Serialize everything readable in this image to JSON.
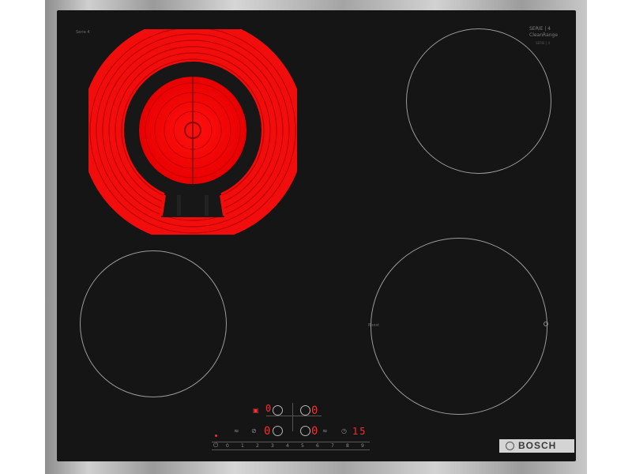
{
  "hob": {
    "top_left_mark": "Serie 4",
    "top_right_badge_line1": "SERIE | 4",
    "top_right_badge_line2": "CleanRange",
    "top_right_badge_line3": "SERIE | 4",
    "zone_bl_label": "",
    "zone_br_left_label": "Boost",
    "zone_br_right_label": "",
    "brand": "BOSCH"
  },
  "controls": {
    "display_front_left": "0",
    "display_front_right": "0",
    "display_rear_left": "0",
    "display_rear_right": "0",
    "timer_display": "15",
    "slider_labels": [
      "0",
      "1",
      "2",
      "3",
      "4",
      "5",
      "6",
      "7",
      "8",
      "9"
    ],
    "active_zone_color": "#ff2020"
  },
  "icons": [
    "power-icon",
    "child-lock-icon",
    "timer-icon",
    "boost-icon",
    "wipe-protection-icon"
  ]
}
